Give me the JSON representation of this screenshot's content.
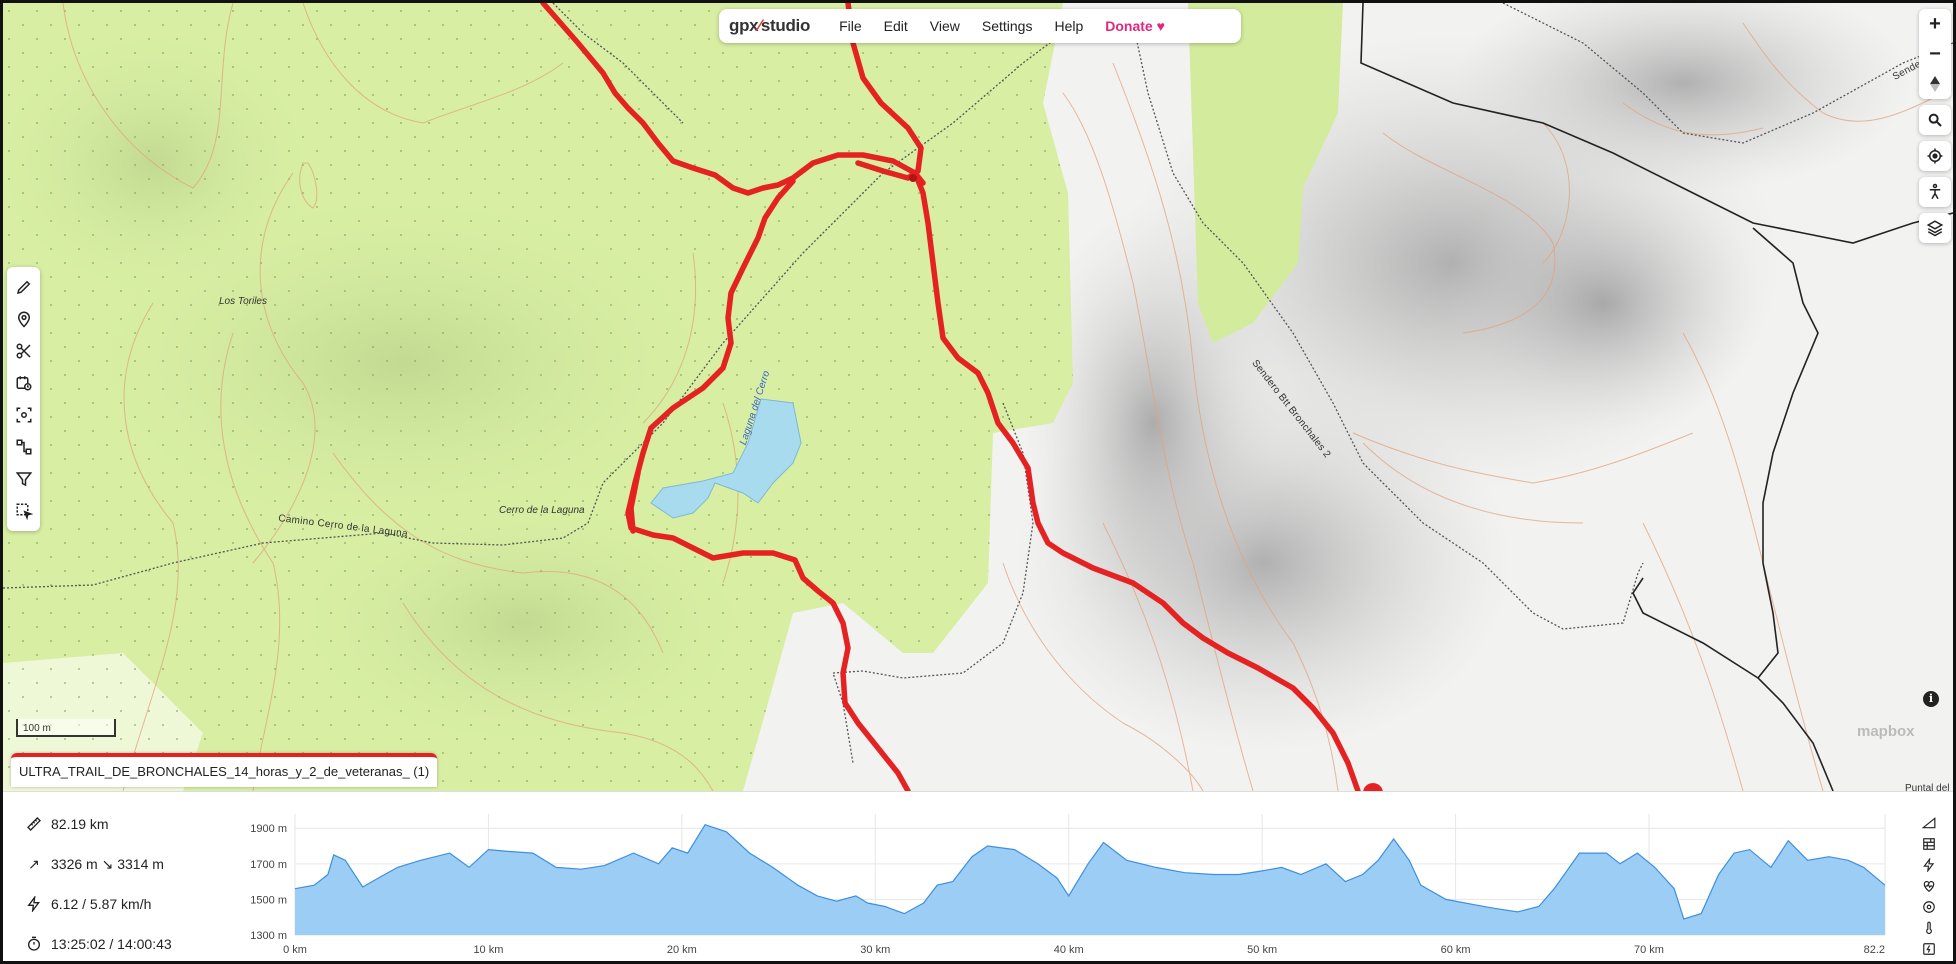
{
  "menu": {
    "logo_gpx": "gpx",
    "logo_studio": "studio",
    "items": [
      "File",
      "Edit",
      "View",
      "Settings",
      "Help"
    ],
    "donate": "Donate"
  },
  "map": {
    "labels": {
      "los_toriles": "Los Toriles",
      "cerro_de_la_laguna": "Cerro de la Laguna",
      "camino": "Camino Cerro de la Laguna",
      "laguna": "Laguna del Cerro",
      "sendero": "Sendero Btt Bronchales 2",
      "sendero_top": "Sendero"
    },
    "scale_label": "100 m",
    "mapbox_logo": "mapbox",
    "attribution": "Puntal del",
    "track_color": "#e52222",
    "forest_color": "#d7eea3",
    "water_color": "#a9dbee"
  },
  "file_tab": {
    "name": "ULTRA_TRAIL_DE_BRONCHALES_14_horas_y_2_de_veteranas_ (1)"
  },
  "stats": {
    "distance": "82.19 km",
    "elevation": "3326 m ↘ 3314 m",
    "speed": "6.12 / 5.87 km/h",
    "time": "13:25:02 / 14:00:43"
  },
  "icons": {
    "left_tools": [
      "pencil-icon",
      "map-pin-icon",
      "scissors-icon",
      "calendar-clock-icon",
      "scan-icon",
      "route-icon",
      "filter-icon",
      "select-icon"
    ],
    "right_tools": [
      "zoom-in-icon",
      "zoom-out-icon",
      "compass-icon",
      "search-icon",
      "locate-icon",
      "person-icon",
      "layers-icon"
    ],
    "profile_tools": [
      "slope-icon",
      "surface-icon",
      "speed-icon",
      "heart-rate-icon",
      "cadence-icon",
      "temperature-icon",
      "power-icon"
    ]
  },
  "chart_data": {
    "type": "area",
    "xlabel": "",
    "ylabel": "",
    "xlim": [
      0,
      82.2
    ],
    "ylim": [
      1300,
      1980
    ],
    "y_ticks": [
      1300,
      1500,
      1700,
      1900
    ],
    "y_tick_labels": [
      "1300 m",
      "1500 m",
      "1700 m",
      "1900 m"
    ],
    "x_ticks": [
      0,
      10,
      20,
      30,
      40,
      50,
      60,
      70,
      82.2
    ],
    "x_tick_labels": [
      "0 km",
      "10 km",
      "20 km",
      "30 km",
      "40 km",
      "50 km",
      "60 km",
      "70 km",
      "82.2"
    ],
    "fill_color": "#9ccdf4",
    "line_color": "#3d8fe0",
    "grid": true,
    "x": [
      0,
      1,
      1.7,
      2,
      2.6,
      3.5,
      4.3,
      5.3,
      6.5,
      8,
      9,
      10,
      11,
      12.3,
      13.5,
      14.8,
      16,
      17.5,
      18.8,
      19.5,
      20.3,
      21.2,
      22.3,
      23.5,
      24.7,
      26,
      27,
      28,
      29,
      29.6,
      30.5,
      31.5,
      32.5,
      33.2,
      34,
      35,
      35.8,
      37.2,
      38.4,
      39.4,
      40,
      41,
      41.8,
      43,
      44.5,
      46,
      47.5,
      48.8,
      50,
      51,
      52,
      53.3,
      54.3,
      55.2,
      56,
      56.8,
      57.6,
      58.2,
      59.5,
      61,
      62,
      63.2,
      64.3,
      65.1,
      66.4,
      67.8,
      68.5,
      69.4,
      70.3,
      71.3,
      71.8,
      72.7,
      73.6,
      74.4,
      75.2,
      76.3,
      77.2,
      78.2,
      79.3,
      80.3,
      81.1,
      82.2
    ],
    "values": [
      1560,
      1580,
      1640,
      1750,
      1720,
      1570,
      1620,
      1680,
      1720,
      1760,
      1680,
      1780,
      1770,
      1760,
      1680,
      1670,
      1690,
      1760,
      1700,
      1790,
      1760,
      1920,
      1880,
      1760,
      1680,
      1580,
      1520,
      1490,
      1520,
      1480,
      1460,
      1420,
      1480,
      1580,
      1600,
      1740,
      1800,
      1780,
      1700,
      1620,
      1520,
      1700,
      1820,
      1720,
      1680,
      1650,
      1640,
      1640,
      1660,
      1680,
      1640,
      1700,
      1600,
      1640,
      1720,
      1840,
      1720,
      1580,
      1500,
      1470,
      1450,
      1430,
      1460,
      1560,
      1760,
      1760,
      1700,
      1760,
      1680,
      1560,
      1390,
      1420,
      1640,
      1760,
      1780,
      1680,
      1830,
      1720,
      1740,
      1720,
      1680,
      1580
    ]
  }
}
